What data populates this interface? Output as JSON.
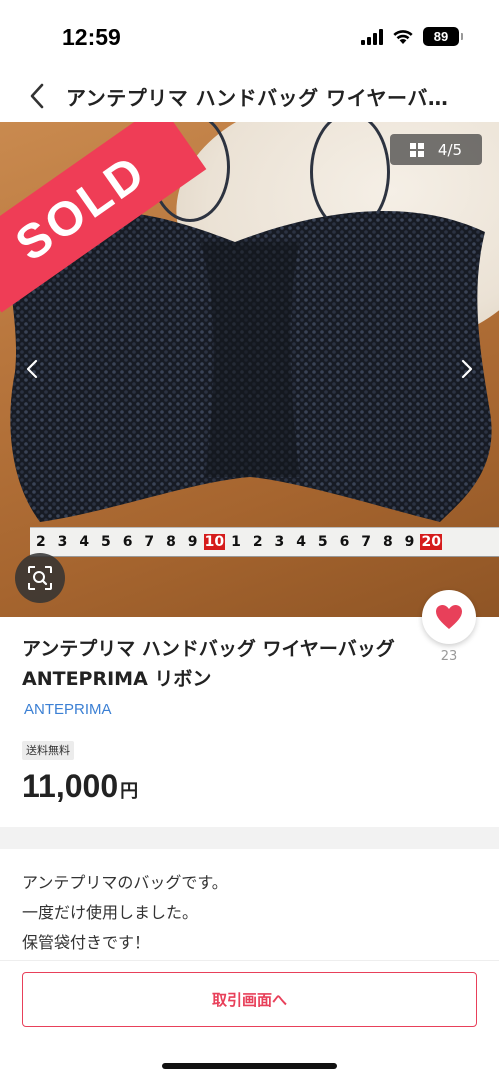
{
  "status": {
    "time": "12:59",
    "battery": "89"
  },
  "header": {
    "title": "アンテプリマ ハンドバッグ ワイヤーバ…"
  },
  "photo": {
    "badge": "SOLD",
    "counter": "4/5",
    "ruler_numbers": [
      "2",
      "3",
      "4",
      "5",
      "6",
      "7",
      "8",
      "9",
      "10",
      "1",
      "2",
      "3",
      "4",
      "5",
      "6",
      "7",
      "8",
      "9",
      "20"
    ]
  },
  "product": {
    "title": "アンテプリマ ハンドバッグ ワイヤーバッグ ANTEPRIMA リボン",
    "brand": "ANTEPRIMA",
    "shipping": "送料無料",
    "price": "11,000",
    "currency": "円",
    "like_count": "23"
  },
  "description": [
    "アンテプリマのバッグです。",
    "一度だけ使用しました。",
    "保管袋付きです！"
  ],
  "actions": {
    "transaction_label": "取引画面へ"
  },
  "colors": {
    "accent": "#e8405a",
    "brand_link": "#3c80d4",
    "sold": "#ef3d56"
  }
}
